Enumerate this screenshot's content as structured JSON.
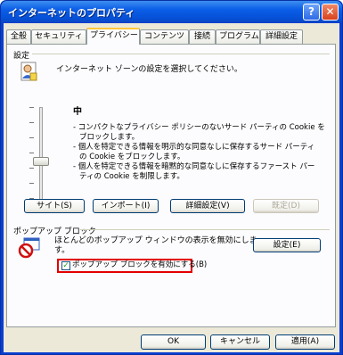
{
  "window": {
    "title": "インターネットのプロパティ",
    "help_glyph": "?",
    "close_glyph": "✕"
  },
  "tabs": [
    {
      "label": "全般",
      "active": false
    },
    {
      "label": "セキュリティ",
      "active": false
    },
    {
      "label": "プライバシー",
      "active": true
    },
    {
      "label": "コンテンツ",
      "active": false
    },
    {
      "label": "接続",
      "active": false
    },
    {
      "label": "プログラム",
      "active": false
    },
    {
      "label": "詳細設定",
      "active": false
    }
  ],
  "settings": {
    "group_label": "設定",
    "instruction": "インターネット ゾーンの設定を選択してください。",
    "level": "中",
    "description": [
      "- コンパクトなプライバシー ポリシーのないサード パーティの Cookie を",
      "ブロックします。",
      "- 個人を特定できる情報を明示的な同意なしに保存するサード パーティ",
      "の Cookie をブロックします。",
      "- 個人を特定できる情報を暗黙的な同意なしに保存するファースト パー",
      "ティの Cookie を制限します。"
    ],
    "buttons": {
      "sites": "サイト(S)",
      "import": "インポート(I)",
      "advanced": "詳細設定(V)",
      "default": "既定(D)"
    },
    "slider_level": 0.55
  },
  "popup": {
    "group_label": "ポップアップ ブロック",
    "description": [
      "ほとんどのポップアップ ウィンドウの表示を無効にしま",
      "す。"
    ],
    "settings_button": "設定(E)",
    "checkbox_label": "ポップアップ ブロックを有効にする(B)",
    "checkbox_checked": true,
    "check_glyph": "✓"
  },
  "footer": {
    "ok": "OK",
    "cancel": "キャンセル",
    "apply": "適用(A)"
  },
  "colors": {
    "titlebar": "#0b5ee7",
    "highlight": "#e30000"
  }
}
